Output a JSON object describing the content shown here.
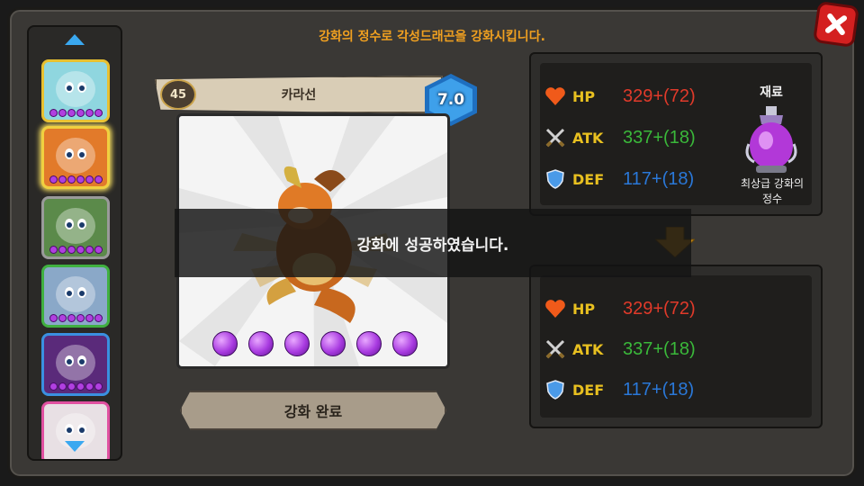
{
  "header": {
    "instruction": "강화의 정수로 각성드래곤을 강화시킵니다."
  },
  "roster": {
    "cards": [
      {
        "name": "white-dragon",
        "bg": "#8fd6df",
        "border": "#e8c030",
        "selected": false,
        "stars": 6
      },
      {
        "name": "orange-dragon",
        "bg": "#e27a2a",
        "border": "#f0d040",
        "selected": true,
        "stars": 6
      },
      {
        "name": "green-dragon",
        "bg": "#5b8a4a",
        "border": "#9a9a9a",
        "selected": false,
        "stars": 6
      },
      {
        "name": "silver-dragon",
        "bg": "#8aa8c8",
        "border": "#40b040",
        "selected": false,
        "stars": 6
      },
      {
        "name": "purple-dragon",
        "bg": "#5a2a7a",
        "border": "#3a90e0",
        "selected": false,
        "stars": 6
      },
      {
        "name": "pink-dragon",
        "bg": "#e8e0e4",
        "border": "#e050a0",
        "selected": false,
        "stars": 0
      }
    ]
  },
  "dragon": {
    "name": "카라선",
    "level": "45",
    "grade": "7.0",
    "star_orbs": 6
  },
  "buttons": {
    "complete": "강화 완료"
  },
  "stats_before": {
    "hp": {
      "label": "HP",
      "value": "329+(72)"
    },
    "atk": {
      "label": "ATK",
      "value": "337+(18)"
    },
    "def": {
      "label": "DEF",
      "value": "117+(18)"
    }
  },
  "stats_after": {
    "hp": {
      "label": "HP",
      "value": "329+(72)"
    },
    "atk": {
      "label": "ATK",
      "value": "337+(18)"
    },
    "def": {
      "label": "DEF",
      "value": "117+(18)"
    }
  },
  "material": {
    "title": "재료",
    "name_line1": "최상급 강화의",
    "name_line2": "정수"
  },
  "toast": {
    "message": "강화에 성공하였습니다."
  },
  "colors": {
    "hp": "#e03a2a",
    "atk": "#3ab83a",
    "def": "#2a78d8",
    "label_hp": "#e8c020",
    "label_atk": "#e8c020",
    "label_def": "#e8c020",
    "accent": "#f0a020"
  }
}
